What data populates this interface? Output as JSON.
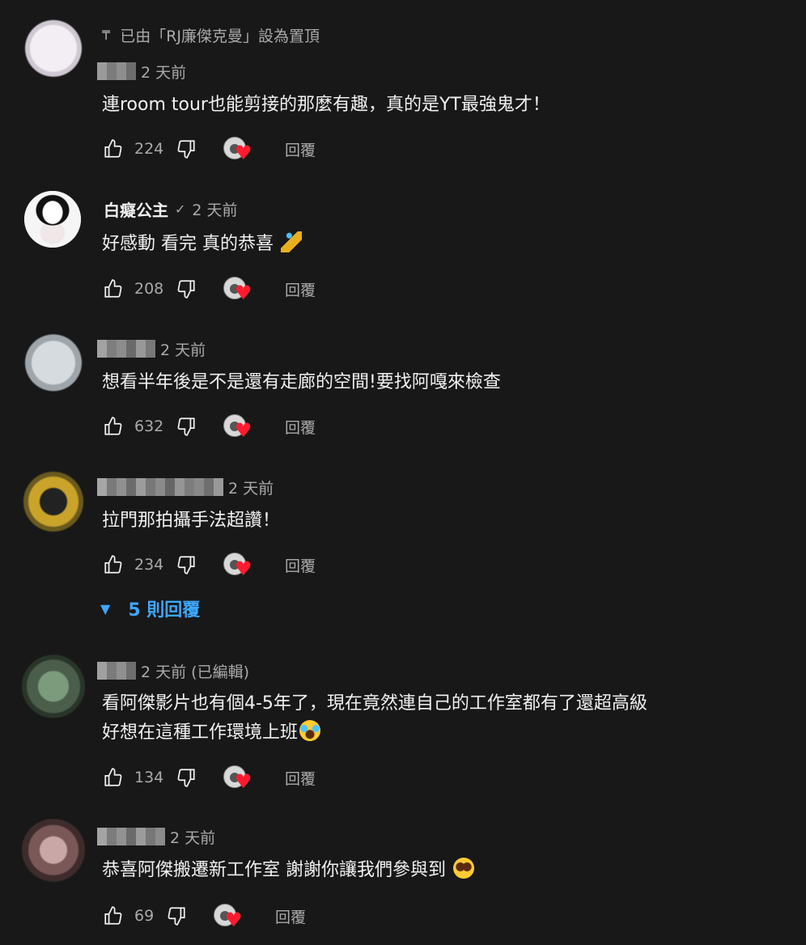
{
  "pinned_banner": {
    "text": "已由「RJ廉傑克曼」設為置頂"
  },
  "comments": [
    {
      "author": "",
      "time": "2 天前",
      "text": "連room tour也能剪接的那麼有趣，真的是YT最強鬼才！",
      "likes": "224",
      "reply_label": "回覆",
      "hearted": true
    },
    {
      "author": "白癡公主",
      "verified": true,
      "time": "2 天前",
      "text": "好感動 看完 真的恭喜",
      "emoji": "party-popper-emoji",
      "likes": "208",
      "reply_label": "回覆",
      "hearted": true
    },
    {
      "author": "",
      "time": "2 天前",
      "text": "想看半年後是不是還有走廊的空間!要找阿嘎來檢查",
      "likes": "632",
      "reply_label": "回覆",
      "hearted": true
    },
    {
      "author": "",
      "time": "2 天前",
      "text": "拉門那拍攝手法超讚！",
      "likes": "234",
      "reply_label": "回覆",
      "hearted": true,
      "replies_toggle": "5 則回覆"
    },
    {
      "author": "",
      "time": "2 天前 (已編輯)",
      "text_line1": "看阿傑影片也有個4-5年了，現在竟然連自己的工作室都有了還超高級",
      "text_line2": "好想在這種工作環境上班",
      "emoji": "laughing-tears-emoji",
      "likes": "134",
      "reply_label": "回覆",
      "hearted": true
    },
    {
      "author": "",
      "time": "2 天前",
      "text": "恭喜阿傑搬遷新工作室 謝謝你讓我們參與到",
      "emoji": "pleading-face-emoji",
      "likes": "69",
      "reply_label": "回覆",
      "hearted": true
    }
  ],
  "colors": {
    "background": "#181818",
    "text_primary": "#f1f1f1",
    "text_secondary": "#aaaaaa",
    "link_blue": "#3ea6ff",
    "heart_red": "#ff1b2d"
  }
}
